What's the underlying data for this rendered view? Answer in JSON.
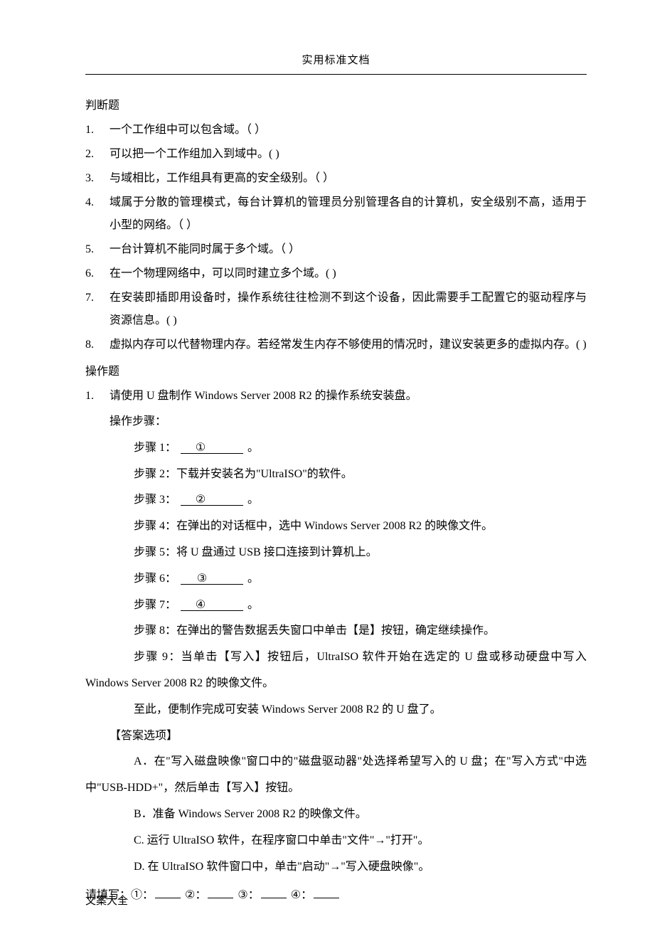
{
  "header": {
    "title": "实用标准文档"
  },
  "footer": {
    "text": "文案大全"
  },
  "section1": {
    "title": "判断题",
    "items": [
      {
        "num": "1.",
        "text": "一个工作组中可以包含域。（    ）"
      },
      {
        "num": "2.",
        "text": "可以把一个工作组加入到域中。(    )"
      },
      {
        "num": "3.",
        "text": "与域相比，工作组具有更高的安全级别。（    ）"
      },
      {
        "num": "4.",
        "text": "域属于分散的管理模式，每台计算机的管理员分别管理各自的计算机，安全级别不高，适用于小型的网络。（    ）"
      },
      {
        "num": "5.",
        "text": "一台计算机不能同时属于多个域。（     ）"
      },
      {
        "num": "6.",
        "text": "在一个物理网络中，可以同时建立多个域。(    )"
      },
      {
        "num": "7.",
        "text": "在安装即插即用设备时，操作系统往往检测不到这个设备，因此需要手工配置它的驱动程序与资源信息。(     )"
      },
      {
        "num": "8.",
        "text": "虚拟内存可以代替物理内存。若经常发生内存不够使用的情况时，建议安装更多的虚拟内存。(     )"
      }
    ]
  },
  "section2": {
    "title": "操作题",
    "q1": {
      "num": "1.",
      "text": "请使用 U 盘制作 Windows Server 2008 R2 的操作系统安装盘。",
      "ops_label": "操作步骤：",
      "step1_prefix": "步骤 1：",
      "step1_circle": "①",
      "step1_suffix": "。",
      "step2": "步骤 2：下载并安装名为\"UltraISO\"的软件。",
      "step3_prefix": "步骤 3：",
      "step3_circle": "②",
      "step3_suffix": "。",
      "step4": "步骤 4：在弹出的对话框中，选中 Windows Server 2008 R2 的映像文件。",
      "step5": "步骤 5：将 U 盘通过 USB 接口连接到计算机上。",
      "step6_prefix": "步骤 6：",
      "step6_circle": "③",
      "step6_suffix": "。",
      "step7_prefix": "步骤 7：",
      "step7_circle": "④",
      "step7_suffix": "。",
      "step8": "步骤 8：在弹出的警告数据丢失窗口中单击【是】按钮，确定继续操作。",
      "step9": "步骤 9：当单击【写入】按钮后，UltraISO 软件开始在选定的 U 盘或移动硬盘中写入 Windows Server 2008 R2 的映像文件。",
      "done": "至此，便制作完成可安装 Windows Server 2008 R2 的 U 盘了。",
      "answer_title": "【答案选项】",
      "optA": "A．在\"写入磁盘映像\"窗口中的\"磁盘驱动器\"处选择希望写入的 U 盘；在\"写入方式\"中选中\"USB-HDD+\"，然后单击【写入】按钮。",
      "optB": "B．准备 Windows Server 2008 R2 的映像文件。",
      "optC": "C. 运行 UltraISO 软件，在程序窗口中单击\"文件\"→\"打开\"。",
      "optD": "D. 在 UltraISO 软件窗口中，单击\"启动\"→\"写入硬盘映像\"。",
      "fill_prefix": "请填写：①：",
      "fill_2": "  ②：",
      "fill_3": "  ③：",
      "fill_4": "  ④："
    }
  }
}
